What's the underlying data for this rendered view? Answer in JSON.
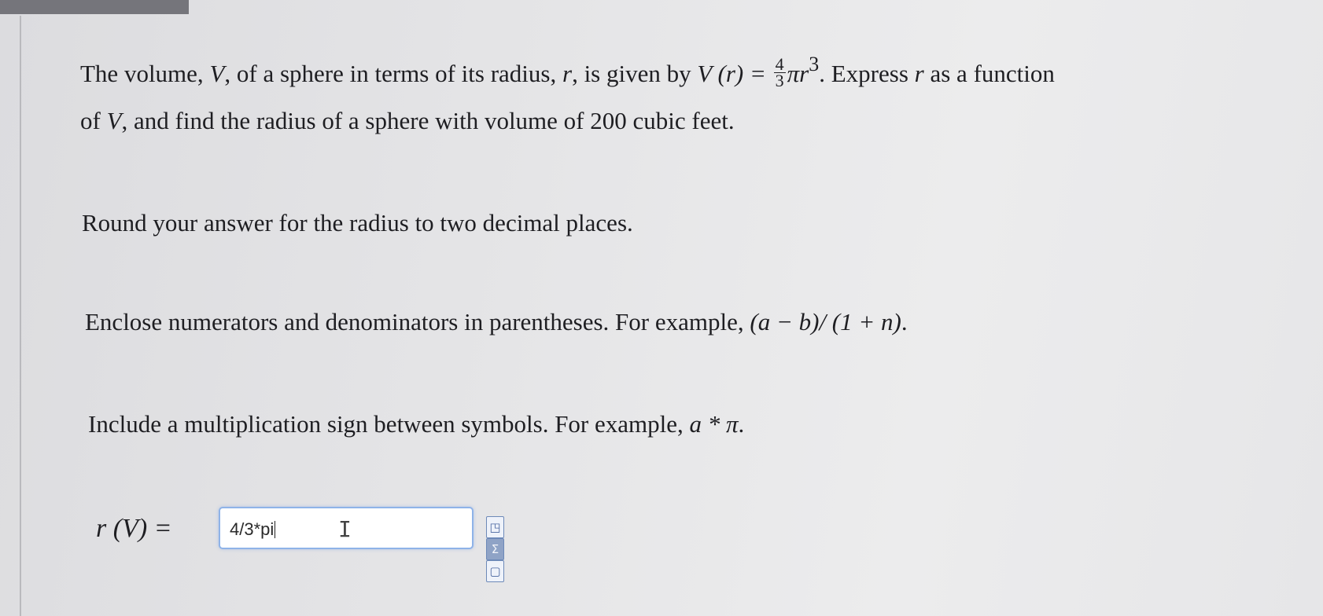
{
  "question": {
    "line1_a": "The volume, ",
    "var_V": "V",
    "line1_b": ", of a sphere in terms of its radius, ",
    "var_r": "r",
    "line1_c": ", is given by ",
    "formula_lhs": "V (r) = ",
    "frac_num": "4",
    "frac_den": "3",
    "formula_rhs": "πr",
    "exponent": "3",
    "line1_d": ". Express ",
    "line1_e": " as a function",
    "line2_a": "of ",
    "line2_b": ", and find the radius of a sphere with volume of 200 cubic feet."
  },
  "instructions": {
    "round": "Round your answer for the radius to two decimal places.",
    "enclose_text": "Enclose numerators and denominators in parentheses. For example, ",
    "enclose_example": "(a − b)/ (1 + n)",
    "enclose_end": ".",
    "multiply_text": "Include a multiplication sign between symbols. For example, ",
    "multiply_example": "a * π",
    "multiply_end": "."
  },
  "answer": {
    "label": "r (V) = ",
    "value": "4/3*pi"
  },
  "tools": {
    "icons": [
      "preview-icon",
      "equation-editor-icon",
      "help-icon"
    ],
    "glyphs": [
      "◳",
      "Σ",
      "▢"
    ]
  }
}
